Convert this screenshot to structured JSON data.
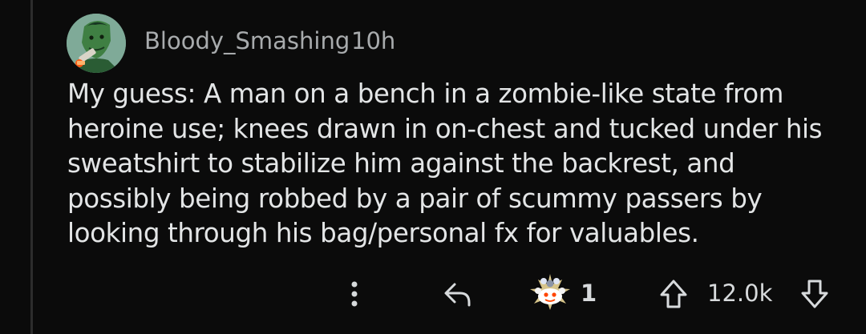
{
  "comment": {
    "username": "Bloody_Smashing",
    "timestamp": "10h",
    "body": "My guess: A man on a bench in a zombie-like state from heroine use; knees drawn in on-chest and tucked under his sweatshirt to stabilize him against the backrest, and possibly being robbed by a pair of scummy passers by looking through his bag/personal fx for valuables."
  },
  "actions": {
    "more_icon": "more-vertical-icon",
    "reply_icon": "reply-arrow-icon",
    "award_icon": "reddit-award-icon",
    "award_count": "1",
    "upvote_icon": "upvote-arrow-icon",
    "score": "12.0k",
    "downvote_icon": "downvote-arrow-icon"
  },
  "colors": {
    "background": "#0b0b0b",
    "text": "#e3e5e6",
    "meta_text": "#a8abad"
  }
}
